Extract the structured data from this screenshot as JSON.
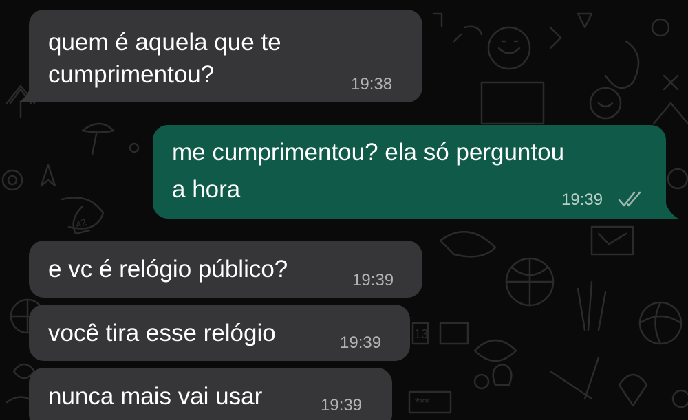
{
  "messages": [
    {
      "direction": "incoming",
      "lines": [
        "quem é aquela que te",
        "cumprimentou?"
      ],
      "time": "19:38"
    },
    {
      "direction": "outgoing",
      "lines": [
        "me cumprimentou? ela só perguntou",
        "a hora"
      ],
      "time": "19:39",
      "status_icon": "double-check-icon"
    },
    {
      "direction": "incoming",
      "lines": [
        "e vc é relógio público?"
      ],
      "time": "19:39"
    },
    {
      "direction": "incoming",
      "lines": [
        "você tira esse relógio"
      ],
      "time": "19:39"
    },
    {
      "direction": "incoming",
      "lines": [
        "nunca mais vai usar"
      ],
      "time": "19:39"
    }
  ],
  "colors": {
    "background": "#0a0a0a",
    "incoming_bubble": "#363638",
    "outgoing_bubble": "#0f5a48",
    "text": "#ffffff",
    "timestamp": "#b3b3b3",
    "doodle": "#2a2a2a"
  },
  "wallpaper_glyphs": {
    "sticker_number": "42",
    "calendar_number": "13",
    "password_dots": "***"
  }
}
